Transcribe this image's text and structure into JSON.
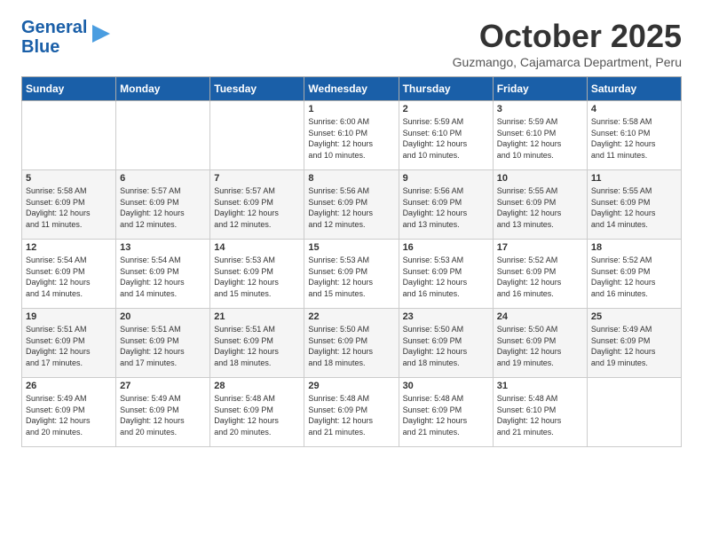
{
  "logo": {
    "line1": "General",
    "line2": "Blue"
  },
  "title": "October 2025",
  "subtitle": "Guzmango, Cajamarca Department, Peru",
  "header_row": [
    "Sunday",
    "Monday",
    "Tuesday",
    "Wednesday",
    "Thursday",
    "Friday",
    "Saturday"
  ],
  "weeks": [
    [
      {
        "day": "",
        "info": ""
      },
      {
        "day": "",
        "info": ""
      },
      {
        "day": "",
        "info": ""
      },
      {
        "day": "1",
        "info": "Sunrise: 6:00 AM\nSunset: 6:10 PM\nDaylight: 12 hours\nand 10 minutes."
      },
      {
        "day": "2",
        "info": "Sunrise: 5:59 AM\nSunset: 6:10 PM\nDaylight: 12 hours\nand 10 minutes."
      },
      {
        "day": "3",
        "info": "Sunrise: 5:59 AM\nSunset: 6:10 PM\nDaylight: 12 hours\nand 10 minutes."
      },
      {
        "day": "4",
        "info": "Sunrise: 5:58 AM\nSunset: 6:10 PM\nDaylight: 12 hours\nand 11 minutes."
      }
    ],
    [
      {
        "day": "5",
        "info": "Sunrise: 5:58 AM\nSunset: 6:09 PM\nDaylight: 12 hours\nand 11 minutes."
      },
      {
        "day": "6",
        "info": "Sunrise: 5:57 AM\nSunset: 6:09 PM\nDaylight: 12 hours\nand 12 minutes."
      },
      {
        "day": "7",
        "info": "Sunrise: 5:57 AM\nSunset: 6:09 PM\nDaylight: 12 hours\nand 12 minutes."
      },
      {
        "day": "8",
        "info": "Sunrise: 5:56 AM\nSunset: 6:09 PM\nDaylight: 12 hours\nand 12 minutes."
      },
      {
        "day": "9",
        "info": "Sunrise: 5:56 AM\nSunset: 6:09 PM\nDaylight: 12 hours\nand 13 minutes."
      },
      {
        "day": "10",
        "info": "Sunrise: 5:55 AM\nSunset: 6:09 PM\nDaylight: 12 hours\nand 13 minutes."
      },
      {
        "day": "11",
        "info": "Sunrise: 5:55 AM\nSunset: 6:09 PM\nDaylight: 12 hours\nand 14 minutes."
      }
    ],
    [
      {
        "day": "12",
        "info": "Sunrise: 5:54 AM\nSunset: 6:09 PM\nDaylight: 12 hours\nand 14 minutes."
      },
      {
        "day": "13",
        "info": "Sunrise: 5:54 AM\nSunset: 6:09 PM\nDaylight: 12 hours\nand 14 minutes."
      },
      {
        "day": "14",
        "info": "Sunrise: 5:53 AM\nSunset: 6:09 PM\nDaylight: 12 hours\nand 15 minutes."
      },
      {
        "day": "15",
        "info": "Sunrise: 5:53 AM\nSunset: 6:09 PM\nDaylight: 12 hours\nand 15 minutes."
      },
      {
        "day": "16",
        "info": "Sunrise: 5:53 AM\nSunset: 6:09 PM\nDaylight: 12 hours\nand 16 minutes."
      },
      {
        "day": "17",
        "info": "Sunrise: 5:52 AM\nSunset: 6:09 PM\nDaylight: 12 hours\nand 16 minutes."
      },
      {
        "day": "18",
        "info": "Sunrise: 5:52 AM\nSunset: 6:09 PM\nDaylight: 12 hours\nand 16 minutes."
      }
    ],
    [
      {
        "day": "19",
        "info": "Sunrise: 5:51 AM\nSunset: 6:09 PM\nDaylight: 12 hours\nand 17 minutes."
      },
      {
        "day": "20",
        "info": "Sunrise: 5:51 AM\nSunset: 6:09 PM\nDaylight: 12 hours\nand 17 minutes."
      },
      {
        "day": "21",
        "info": "Sunrise: 5:51 AM\nSunset: 6:09 PM\nDaylight: 12 hours\nand 18 minutes."
      },
      {
        "day": "22",
        "info": "Sunrise: 5:50 AM\nSunset: 6:09 PM\nDaylight: 12 hours\nand 18 minutes."
      },
      {
        "day": "23",
        "info": "Sunrise: 5:50 AM\nSunset: 6:09 PM\nDaylight: 12 hours\nand 18 minutes."
      },
      {
        "day": "24",
        "info": "Sunrise: 5:50 AM\nSunset: 6:09 PM\nDaylight: 12 hours\nand 19 minutes."
      },
      {
        "day": "25",
        "info": "Sunrise: 5:49 AM\nSunset: 6:09 PM\nDaylight: 12 hours\nand 19 minutes."
      }
    ],
    [
      {
        "day": "26",
        "info": "Sunrise: 5:49 AM\nSunset: 6:09 PM\nDaylight: 12 hours\nand 20 minutes."
      },
      {
        "day": "27",
        "info": "Sunrise: 5:49 AM\nSunset: 6:09 PM\nDaylight: 12 hours\nand 20 minutes."
      },
      {
        "day": "28",
        "info": "Sunrise: 5:48 AM\nSunset: 6:09 PM\nDaylight: 12 hours\nand 20 minutes."
      },
      {
        "day": "29",
        "info": "Sunrise: 5:48 AM\nSunset: 6:09 PM\nDaylight: 12 hours\nand 21 minutes."
      },
      {
        "day": "30",
        "info": "Sunrise: 5:48 AM\nSunset: 6:09 PM\nDaylight: 12 hours\nand 21 minutes."
      },
      {
        "day": "31",
        "info": "Sunrise: 5:48 AM\nSunset: 6:10 PM\nDaylight: 12 hours\nand 21 minutes."
      },
      {
        "day": "",
        "info": ""
      }
    ]
  ]
}
